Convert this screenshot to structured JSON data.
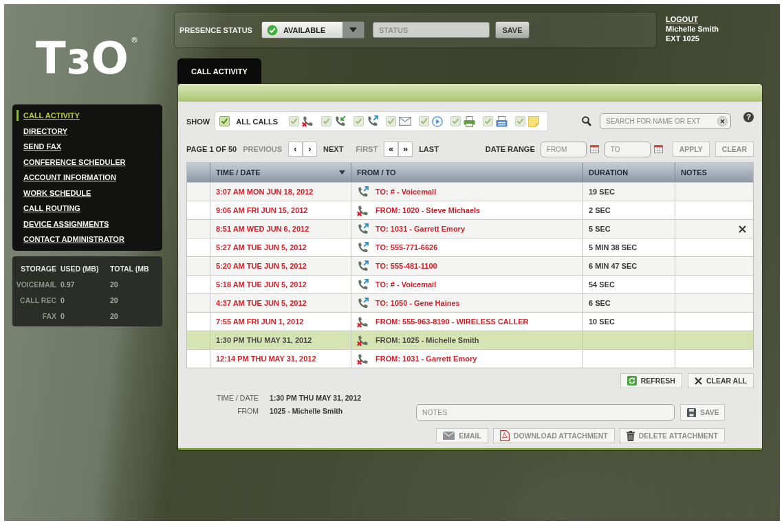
{
  "logo": {
    "text": "TɜO",
    "mark": "®"
  },
  "presence": {
    "label": "PRESENCE STATUS",
    "status": {
      "value": "AVAILABLE",
      "kind": "available"
    },
    "status_field": {
      "placeholder": "STATUS"
    },
    "save": "SAVE"
  },
  "user": {
    "logout": "LOGOUT",
    "name": "Michelle Smith",
    "extension": "EXT 1025"
  },
  "sidebar": {
    "items": [
      {
        "label": "CALL ACTIVITY",
        "selected": true
      },
      {
        "label": "DIRECTORY",
        "selected": false
      },
      {
        "label": "SEND FAX",
        "selected": false
      },
      {
        "label": "CONFERENCE SCHEDULER",
        "selected": false
      },
      {
        "label": "ACCOUNT INFORMATION",
        "selected": false
      },
      {
        "label": "WORK SCHEDULE",
        "selected": false
      },
      {
        "label": "CALL ROUTING",
        "selected": false
      },
      {
        "label": "DEVICE ASSIGNMENTS",
        "selected": false
      },
      {
        "label": "CONTACT ADMINISTRATOR",
        "selected": false
      }
    ]
  },
  "storage": {
    "columns": [
      "STORAGE",
      "USED (MB)",
      "TOTAL (MB"
    ],
    "rows": [
      [
        "VOICEMAIL",
        "0.97",
        "20"
      ],
      [
        "CALL REC",
        "0",
        "20"
      ],
      [
        "FAX",
        "0",
        "20"
      ]
    ]
  },
  "tabs": [
    {
      "label": "CALL ACTIVITY",
      "selected": true
    }
  ],
  "filters": {
    "label": "SHOW",
    "all": {
      "label": "ALL CALLS",
      "checked": true
    },
    "items": [
      {
        "kind": "missed",
        "checked": true
      },
      {
        "kind": "incoming",
        "checked": true
      },
      {
        "kind": "outgoing",
        "checked": true
      },
      {
        "kind": "message",
        "checked": true
      },
      {
        "kind": "voicemail",
        "checked": true
      },
      {
        "kind": "print",
        "checked": true
      },
      {
        "kind": "fax",
        "checked": true
      },
      {
        "kind": "note",
        "checked": true
      }
    ]
  },
  "search": {
    "placeholder": "SEARCH FOR NAME OR EXT",
    "help": "?"
  },
  "pager": {
    "page": "PAGE 1 OF 50",
    "previous": {
      "label": "PREVIOUS",
      "disabled": true
    },
    "prev_arrow": "‹",
    "next_arrow": "›",
    "next": {
      "label": "NEXT",
      "disabled": false
    },
    "first": {
      "label": "FIRST",
      "disabled": true
    },
    "first_arrow": "«",
    "last_arrow": "»",
    "last": {
      "label": "LAST",
      "disabled": false
    }
  },
  "date_range": {
    "label": "DATE RANGE",
    "from": {
      "placeholder": "FROM"
    },
    "to": {
      "placeholder": "TO"
    },
    "apply": {
      "label": "APPLY",
      "disabled": true
    },
    "clear": {
      "label": "CLEAR",
      "disabled": true
    }
  },
  "table": {
    "columns": [
      {
        "label": "TIME / DATE",
        "sorted": true
      },
      {
        "label": "FROM / TO",
        "sorted": false
      },
      {
        "label": "DURATION",
        "sorted": false
      },
      {
        "label": "NOTES",
        "sorted": false
      }
    ],
    "rows": [
      {
        "time": "3:07 AM MON JUN 18, 2012",
        "kind": "outgoing",
        "party": "TO: # - Voicemail",
        "duration": "19 SEC",
        "selected": false,
        "removable": false
      },
      {
        "time": "9:06 AM FRI JUN 15, 2012",
        "kind": "missed",
        "party": "FROM: 1020 - Steve Michaels",
        "duration": "2 SEC",
        "selected": false,
        "removable": false
      },
      {
        "time": "8:51 AM WED JUN 6, 2012",
        "kind": "outgoing",
        "party": "TO: 1031 - Garrett Emory",
        "duration": "5 SEC",
        "selected": false,
        "removable": true
      },
      {
        "time": "5:27 AM TUE JUN 5, 2012",
        "kind": "outgoing",
        "party": "TO: 555-771-6626",
        "duration": "5 MIN 38 SEC",
        "selected": false,
        "removable": false
      },
      {
        "time": "5:20 AM TUE JUN 5, 2012",
        "kind": "outgoing",
        "party": "TO: 555-481-1100",
        "duration": "6 MIN 47 SEC",
        "selected": false,
        "removable": false
      },
      {
        "time": "5:18 AM TUE JUN 5, 2012",
        "kind": "outgoing",
        "party": "TO: # - Voicemail",
        "duration": "54 SEC",
        "selected": false,
        "removable": false
      },
      {
        "time": "4:37 AM TUE JUN 5, 2012",
        "kind": "outgoing",
        "party": "TO: 1050 - Gene Haines",
        "duration": "6 SEC",
        "selected": false,
        "removable": false
      },
      {
        "time": "7:55 AM FRI JUN 1, 2012",
        "kind": "missed",
        "party": "FROM: 555-963-8190 - WIRELESS CALLER",
        "duration": "10 SEC",
        "selected": false,
        "removable": false
      },
      {
        "time": "1:30 PM THU MAY 31, 2012",
        "kind": "missed",
        "party": "FROM: 1025 - Michelle Smith",
        "selected": true,
        "removable": false
      },
      {
        "time": "12:14 PM THU MAY 31, 2012",
        "kind": "missed",
        "party": "FROM: 1031 - Garrett Emory",
        "selected": false,
        "removable": false
      }
    ]
  },
  "table_actions": {
    "refresh": "REFRESH",
    "clear_all": "CLEAR ALL"
  },
  "details": {
    "fields": [
      {
        "label": "TIME / DATE",
        "value": "1:30 PM THU MAY 31, 2012"
      },
      {
        "label": "FROM",
        "value": "1025 - Michelle Smith"
      }
    ],
    "notes": {
      "placeholder": "NOTES"
    },
    "save": {
      "label": "SAVE",
      "disabled": true
    },
    "actions": [
      {
        "kind": "email",
        "label": "EMAIL",
        "disabled": true
      },
      {
        "kind": "download",
        "label": "DOWNLOAD ATTACHMENT",
        "disabled": true
      },
      {
        "kind": "delete",
        "label": "DELETE ATTACHMENT",
        "disabled": true
      }
    ]
  }
}
